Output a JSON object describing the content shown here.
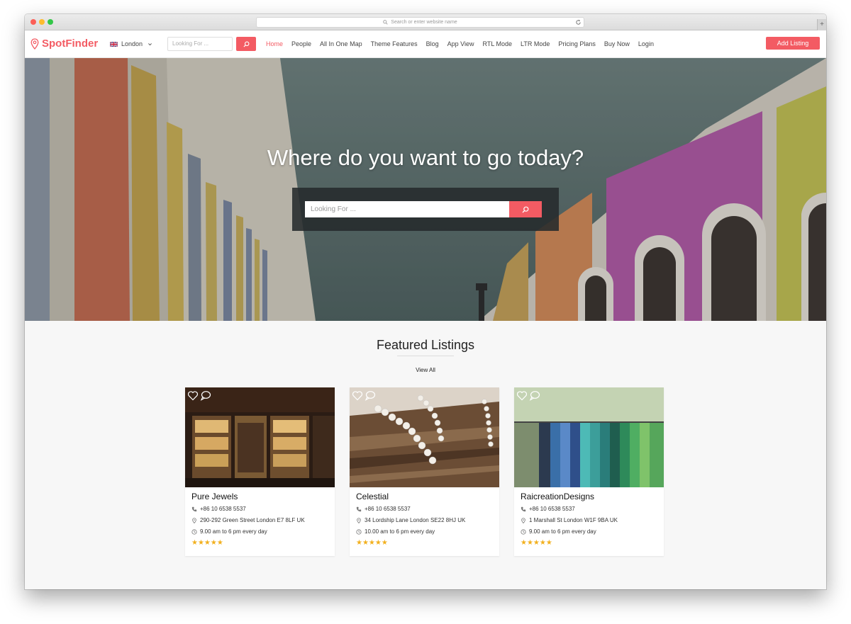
{
  "browser": {
    "address_placeholder": "Search or enter website name",
    "new_tab": "+"
  },
  "header": {
    "logo": "SpotFinder",
    "city": "London",
    "search_placeholder": "Looking For ...",
    "nav": [
      "Home",
      "People",
      "All In One Map",
      "Theme Features",
      "Blog",
      "App View",
      "RTL Mode",
      "LTR Mode",
      "Pricing Plans",
      "Buy Now",
      "Login"
    ],
    "active_nav": "Home",
    "add_listing": "Add Listing"
  },
  "hero": {
    "title": "Where do you want to go today?",
    "search_placeholder": "Looking For ..."
  },
  "featured": {
    "title": "Featured Listings",
    "view_all": "View All",
    "listings": [
      {
        "name": "Pure Jewels",
        "phone": "+86 10 6538 5537",
        "address": "290-292 Green Street London E7 8LF UK",
        "hours": "9.00 am to 6 pm every day",
        "rating": 5,
        "stars": "★★★★★"
      },
      {
        "name": "Celestial",
        "phone": "+86 10 6538 5537",
        "address": "34 Lordship Lane London SE22 8HJ UK",
        "hours": "10.00 am to 6 pm every day",
        "rating": 5,
        "stars": "★★★★★"
      },
      {
        "name": "RaicreationDesigns",
        "phone": "+86 10 6538 5537",
        "address": "1 Marshall St London W1F 9BA UK",
        "hours": "9.00 am to 6 pm every day",
        "rating": 5,
        "stars": "★★★★★"
      }
    ]
  },
  "colors": {
    "accent": "#f35b63",
    "star": "#f2b01e"
  },
  "icons": [
    "map-pin-icon",
    "uk-flag-icon",
    "chevron-down-icon",
    "search-icon",
    "heart-icon",
    "comment-icon",
    "phone-icon",
    "location-icon",
    "clock-icon",
    "reload-icon"
  ]
}
